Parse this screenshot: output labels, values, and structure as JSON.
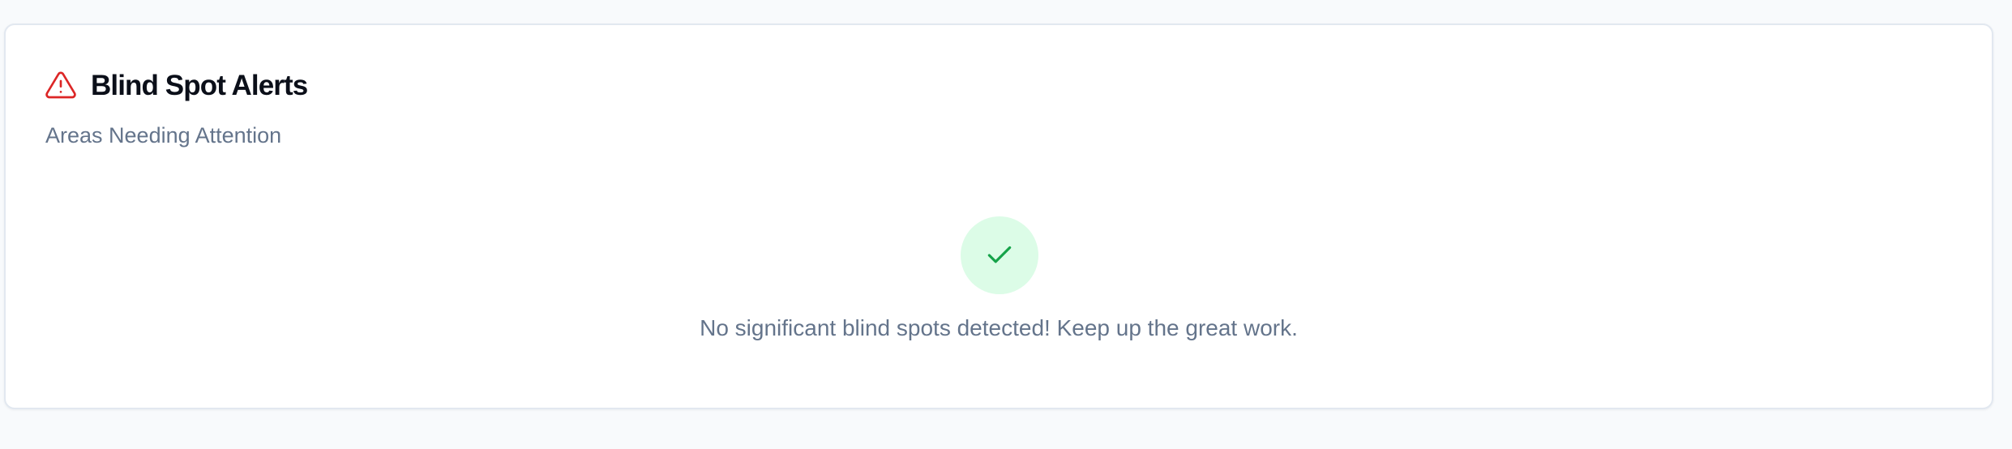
{
  "card": {
    "title": "Blind Spot Alerts",
    "subtitle": "Areas Needing Attention",
    "title_icon": "alert-triangle-icon",
    "status_icon": "check-icon",
    "empty_message": "No significant blind spots detected! Keep up the great work."
  },
  "colors": {
    "page_background": "#f8fafc",
    "card_background": "#ffffff",
    "alert": "#dc2626",
    "success": "#16a34a",
    "success_background": "#dcfce7",
    "muted_text": "#64748b"
  }
}
